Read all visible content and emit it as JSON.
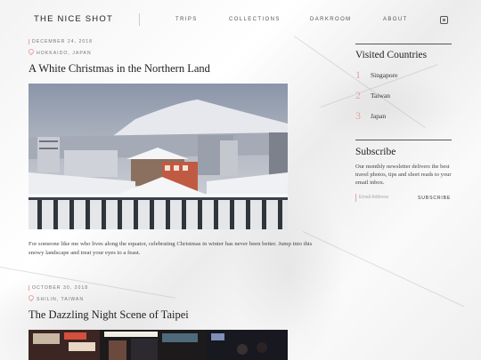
{
  "header": {
    "logo": "THE NICE SHOT",
    "nav": [
      "TRIPS",
      "COLLECTIONS",
      "DARKROOM",
      "ABOUT"
    ],
    "social_icon": "instagram-icon"
  },
  "posts": [
    {
      "date": "DECEMBER 24, 2018",
      "location": "HOKKAIDO, JAPAN",
      "title": "A White Christmas in the Northern Land",
      "excerpt": "For someone like me who lives along the equator, celebrating Christmas in winter has never been better. Jump into this snowy landscape and treat your eyes to a feast."
    },
    {
      "date": "OCTOBER 30, 2018",
      "location": "SHILIN, TAIWAN",
      "title": "The Dazzling Night Scene of Taipei"
    }
  ],
  "sidebar": {
    "visited_title": "Visited Countries",
    "countries": [
      {
        "num": "1",
        "name": "Singapore"
      },
      {
        "num": "2",
        "name": "Taiwan"
      },
      {
        "num": "3",
        "name": "Japan"
      }
    ],
    "subscribe_title": "Subscribe",
    "subscribe_text": "Our monthly newsletter delivers the best travel photos, tips and short reads to your email inbox.",
    "email_placeholder": "Email Address",
    "subscribe_button": "SUBSCRIBE"
  },
  "colors": {
    "accent": "#e8a3a3",
    "text": "#333333"
  }
}
